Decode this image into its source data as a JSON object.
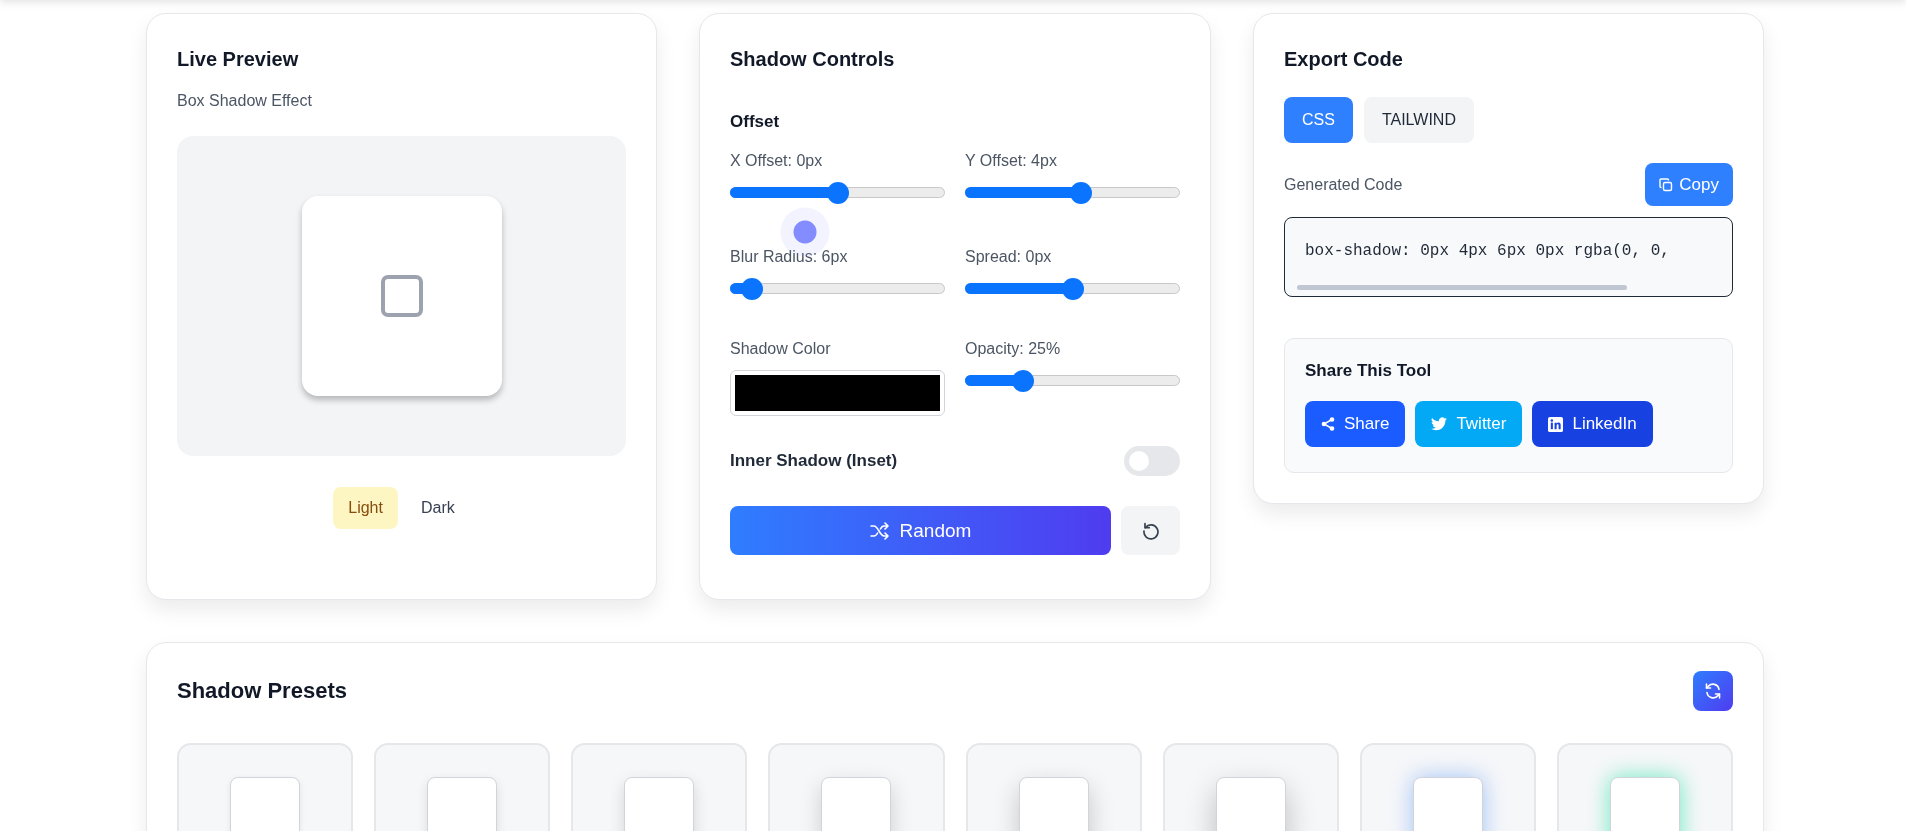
{
  "preview": {
    "title": "Live Preview",
    "subtitle": "Box Shadow Effect",
    "themes": [
      {
        "label": "Light",
        "selected": true
      },
      {
        "label": "Dark",
        "selected": false
      }
    ]
  },
  "controls": {
    "title": "Shadow Controls",
    "section": "Offset",
    "sliders": [
      {
        "label": "X Offset: 0px",
        "level": 0.5
      },
      {
        "label": "Y Offset: 4px",
        "level": 0.54
      },
      {
        "label": "Blur Radius: 6px",
        "level": 0.1
      },
      {
        "label": "Spread: 0px",
        "level": 0.5
      }
    ],
    "shadow_color": {
      "label": "Shadow Color",
      "color": "#000000"
    },
    "opacity": {
      "label": "Opacity: 25%",
      "level": 0.27
    },
    "inset": {
      "label": "Inner Shadow (Inset)",
      "on": false
    },
    "random_button": "Random"
  },
  "export": {
    "title": "Export Code",
    "tabs": [
      {
        "label": "CSS",
        "selected": true
      },
      {
        "label": "TAILWIND",
        "selected": false
      }
    ],
    "code_label": "Generated Code",
    "copy_button": "Copy",
    "code": "box-shadow: 0px 4px 6px 0px rgba(0, 0,",
    "share": {
      "title": "Share This Tool",
      "buttons": [
        {
          "kind": "share",
          "label": "Share",
          "color": "#1a5cff"
        },
        {
          "kind": "twitter",
          "label": "Twitter",
          "color": "#03a9f4"
        },
        {
          "kind": "linkedin",
          "label": "LinkedIn",
          "color": "#1741e0"
        }
      ]
    }
  },
  "presets": {
    "title": "Shadow Presets",
    "items": [
      {
        "kind": "plain"
      },
      {
        "kind": "plain"
      },
      {
        "kind": "plain"
      },
      {
        "kind": "plain"
      },
      {
        "kind": "plain"
      },
      {
        "kind": "plain"
      },
      {
        "kind": "blue_glow"
      },
      {
        "kind": "green_glow"
      }
    ]
  }
}
